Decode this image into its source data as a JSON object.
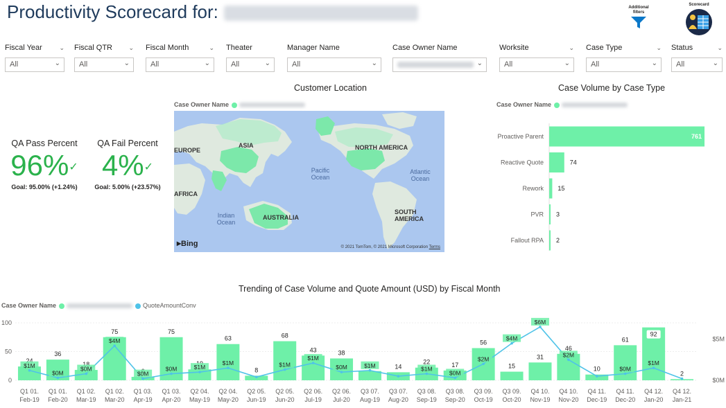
{
  "header": {
    "title": "Productivity Scorecard for:",
    "additional_filters_label": "Additional filters",
    "scorecard_label": "Scorecard"
  },
  "filters": [
    {
      "label": "Fiscal Year",
      "value": "All"
    },
    {
      "label": "Fiscal QTR",
      "value": "All"
    },
    {
      "label": "Fiscal Month",
      "value": "All"
    },
    {
      "label": "Theater",
      "value": "All"
    },
    {
      "label": "Manager Name",
      "value": "All"
    },
    {
      "label": "Case Owner Name",
      "value": ""
    },
    {
      "label": "Worksite",
      "value": "All"
    },
    {
      "label": "Case Type",
      "value": "All"
    },
    {
      "label": "Status",
      "value": "All"
    }
  ],
  "kpis": {
    "pass": {
      "label": "QA Pass Percent",
      "value": "96%",
      "goal": "Goal: 95.00% (+1.24%)"
    },
    "fail": {
      "label": "QA Fail Percent",
      "value": "4%",
      "goal": "Goal: 5.00% (+23.57%)"
    }
  },
  "map": {
    "title": "Customer Location",
    "legend_label": "Case Owner Name",
    "continents": {
      "europe": "EUROPE",
      "asia": "ASIA",
      "africa": "AFRICA",
      "north_america": "NORTH AMERICA",
      "south_america": "SOUTH AMERICA",
      "australia": "AUSTRALIA"
    },
    "oceans": {
      "pacific": "Pacific Ocean",
      "atlantic": "Atlantic Ocean",
      "indian": "Indian Ocean"
    },
    "provider": "Bing",
    "copyright": "© 2021 TomTom, © 2021 Microsoft Corporation",
    "terms": "Terms"
  },
  "colors": {
    "accent_green": "#6ef0a8",
    "line_blue": "#4fc3e8",
    "kpi_green": "#2bb24c",
    "title_navy": "#1f3b5c"
  },
  "chart_data": [
    {
      "type": "bar",
      "title": "Case Volume by Case Type",
      "legend_label": "Case Owner Name",
      "orientation": "horizontal",
      "categories": [
        "Proactive Parent",
        "Reactive Quote",
        "Rework",
        "PVR",
        "Fallout RPA"
      ],
      "values": [
        761,
        74,
        15,
        3,
        2
      ]
    },
    {
      "type": "bar",
      "title": "Trending of Case Volume and Quote Amount (USD) by Fiscal Month",
      "legend_label": "Case Owner Name",
      "categories": [
        "Q1 01.|Feb-19",
        "Q1 01.|Feb-20",
        "Q1 02.|Mar-19",
        "Q1 02.|Mar-20",
        "Q1 03.|Apr-19",
        "Q1 03.|Apr-20",
        "Q2 04.|May-19",
        "Q2 04.|May-20",
        "Q2 05.|Jun-19",
        "Q2 05.|Jun-20",
        "Q2 06.|Jul-19",
        "Q2 06.|Jul-20",
        "Q3 07.|Aug-19",
        "Q3 07.|Aug-20",
        "Q3 08.|Sep-19",
        "Q3 08.|Sep-20",
        "Q3 09.|Oct-19",
        "Q3 09.|Oct-20",
        "Q4 10.|Nov-19",
        "Q4 10.|Nov-20",
        "Q4 11.|Dec-19",
        "Q4 11.|Dec-20",
        "Q4 12.|Jan-20",
        "Q4 12.|Jan-21"
      ],
      "series": [
        {
          "name": "",
          "kind": "bar",
          "values": [
            24,
            36,
            18,
            75,
            6,
            75,
            19,
            63,
            8,
            68,
            43,
            38,
            16,
            14,
            22,
            17,
            56,
            15,
            31,
            46,
            10,
            61,
            92,
            2
          ]
        },
        {
          "name": "QuoteAmountConv",
          "kind": "line",
          "values": [
            1.2,
            0.3,
            0.8,
            4.2,
            0.2,
            0.8,
            1.0,
            1.5,
            0.4,
            1.3,
            2.1,
            1.0,
            1.2,
            0.5,
            0.8,
            0.3,
            2.0,
            4.5,
            6.5,
            2.5,
            0.5,
            0.8,
            1.5,
            0.2
          ]
        }
      ],
      "bar_labels": [
        "24",
        "36",
        "18",
        "75",
        "6",
        "75",
        "19",
        "63",
        "8",
        "68",
        "43",
        "38",
        "16",
        "14",
        "22",
        "17",
        "56",
        "15",
        "31",
        "46",
        "10",
        "61",
        "92",
        "2"
      ],
      "line_labels": [
        "$1M",
        "$0M",
        "$0M",
        "$4M",
        "$0M",
        "$0M",
        "$1M",
        "$1M",
        "",
        "$1M",
        "$1M",
        "$0M",
        "$1M",
        "",
        "$1M",
        "$0M",
        "$2M",
        "$4M",
        "$6M",
        "$2M",
        "",
        "$0M",
        "$1M",
        ""
      ],
      "y_left": {
        "ticks": [
          0,
          50,
          100
        ],
        "labels": [
          "0",
          "50",
          "100"
        ],
        "range": [
          0,
          100
        ]
      },
      "y_right": {
        "labels": [
          "$0M",
          "$5M"
        ],
        "range": [
          0,
          7
        ]
      }
    }
  ]
}
